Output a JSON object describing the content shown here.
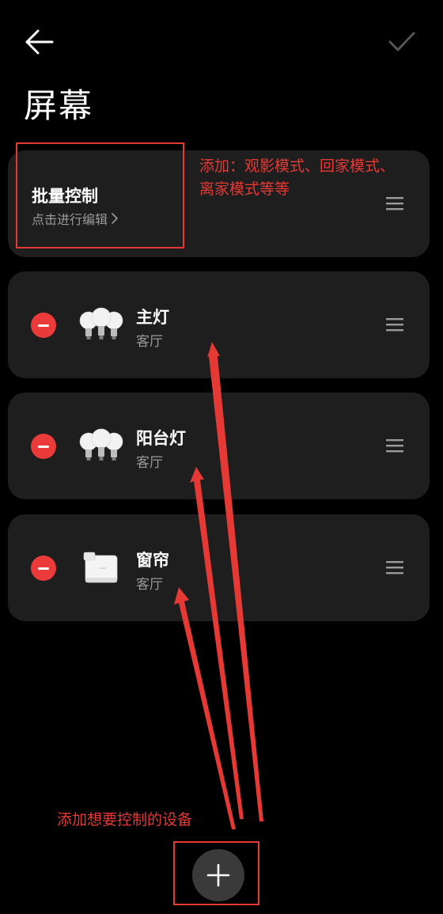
{
  "header": {
    "back_icon": "arrow-left-icon",
    "confirm_icon": "checkmark-icon",
    "title": "屏幕"
  },
  "batch_control": {
    "title": "批量控制",
    "subtitle": "点击进行编辑"
  },
  "devices": [
    {
      "name": "主灯",
      "room": "客厅",
      "icon": "bulbs-icon"
    },
    {
      "name": "阳台灯",
      "room": "客厅",
      "icon": "bulbs-icon"
    },
    {
      "name": "窗帘",
      "room": "客厅",
      "icon": "curtain-motor-icon"
    }
  ],
  "annotations": {
    "top_note": "添加：观影模式、回家模式、离家模式等等",
    "bottom_note": "添加想要控制的设备"
  },
  "colors": {
    "background": "#000000",
    "card": "#1e1e1e",
    "remove": "#ea3a3a",
    "annotation": "#e53935",
    "secondary_text": "#9a9a9a"
  }
}
